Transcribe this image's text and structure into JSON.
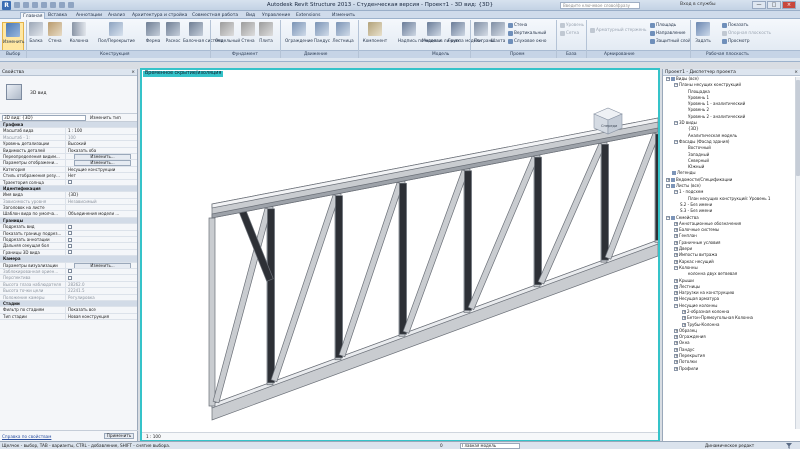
{
  "app": {
    "title": "Autodesk Revit Structure 2013 - Студенческая версия -     Проект1 - 3D вид: {3D}",
    "logo": "R",
    "search_placeholder": "Введите ключевое слово/фразу",
    "signin": "Вход в службы",
    "window_controls": [
      "—",
      "□",
      "×"
    ]
  },
  "tabs": [
    "Главная",
    "Вставка",
    "Аннотации",
    "Анализ",
    "Архитектура и стройка",
    "Совместная работа",
    "Вид",
    "Управление",
    "Extensions",
    "Изменить"
  ],
  "ribbon": {
    "buttons": [
      {
        "label": "Изменить",
        "icon": "cursor-icon"
      },
      {
        "label": "Балка",
        "icon": "beam-icon"
      },
      {
        "label": "Стена",
        "icon": "wall-icon"
      },
      {
        "label": "Колонна",
        "icon": "column-icon"
      },
      {
        "label": "Пол/Перекрытие",
        "icon": "floor-icon"
      },
      {
        "label": "Ферма",
        "icon": "truss-icon"
      },
      {
        "label": "Раскос",
        "icon": "brace-icon"
      },
      {
        "label": "Балочная система",
        "icon": "beam-system-icon"
      },
      {
        "label": "Отдельный",
        "icon": "isolated-footing-icon"
      },
      {
        "label": "Стена",
        "icon": "wall-foundation-icon"
      },
      {
        "label": "Плита",
        "icon": "slab-icon"
      },
      {
        "label": "Ограждение",
        "icon": "railing-icon"
      },
      {
        "label": "Пандус",
        "icon": "ramp-icon"
      },
      {
        "label": "Лестница",
        "icon": "stair-icon"
      },
      {
        "label": "Компонент",
        "icon": "component-icon"
      },
      {
        "label": "Надпись по модели",
        "icon": "model-text-icon"
      },
      {
        "label": "Модель в линиях",
        "icon": "model-line-icon"
      },
      {
        "label": "Группа модели",
        "icon": "model-group-icon"
      },
      {
        "label": "По грани",
        "icon": "by-face-icon"
      },
      {
        "label": "Шахта",
        "icon": "shaft-icon"
      },
      {
        "label": "Задать",
        "icon": "set-workplane-icon"
      }
    ],
    "small_items": {
      "opening": [
        "Стена",
        "Вертикальный",
        "Слуховое окно"
      ],
      "datum": [
        "Уровень",
        "Сетка"
      ],
      "rebar": [
        "Арматурный стержень"
      ],
      "workplane": [
        "Площадь",
        "Направление",
        "Защитный слой",
        "Показать",
        "Опорная плоскость",
        "Просмотр"
      ]
    },
    "panels": [
      "Выбор",
      "Конструкция",
      "Фундамент",
      "Движение",
      "Модель",
      "Проем",
      "База",
      "Армирование",
      "Рабочая плоскость"
    ]
  },
  "properties": {
    "title": "Свойства",
    "close": "×",
    "type_name": "3D вид",
    "type_select": "3D вид: {3D}",
    "edit_type": "Изменить тип",
    "rows": [
      {
        "group": "Графика"
      },
      {
        "k": "Масштаб вида",
        "v": "1 : 100"
      },
      {
        "k": "Масштаб - 1:",
        "v": "100",
        "dim": true
      },
      {
        "k": "Уровень детализации",
        "v": "Высокий"
      },
      {
        "k": "Видимость деталей",
        "v": "Показать оба"
      },
      {
        "k": "Переопределения видим...",
        "v": "Изменить...",
        "btn": true
      },
      {
        "k": "Параметры отображени...",
        "v": "Изменить...",
        "btn": true
      },
      {
        "k": "Категория",
        "v": "Несущие конструкции"
      },
      {
        "k": "Стиль отображения резу...",
        "v": "Нет"
      },
      {
        "k": "Траектория солнца",
        "cb": true
      },
      {
        "group": "Идентификация"
      },
      {
        "k": "Имя вида",
        "v": "{3D}"
      },
      {
        "k": "Зависимость уровня",
        "v": "Независимый",
        "dim": true
      },
      {
        "k": "Заголовок на листе",
        "v": ""
      },
      {
        "k": "Шаблон вида по умолча...",
        "v": "Объединения модели ..."
      },
      {
        "group": "Границы"
      },
      {
        "k": "Подрезать вид",
        "cb": true
      },
      {
        "k": "Показать границу подрез...",
        "cb": true
      },
      {
        "k": "Подрезать аннотации",
        "cb": true
      },
      {
        "k": "Дальняя секущая бол",
        "cb": true
      },
      {
        "k": "Границы 3D вида",
        "cb": true
      },
      {
        "group": "Камера"
      },
      {
        "k": "Параметры визуализации",
        "v": "Изменить...",
        "btn": true
      },
      {
        "k": "Заблокированная ориен...",
        "cb": true,
        "dim": true
      },
      {
        "k": "Перспектива",
        "cb": true,
        "dim": true
      },
      {
        "k": "Высота глаза наблюдателя",
        "v": "28262.0",
        "dim": true
      },
      {
        "k": "Высота точки цели",
        "v": "22241.5",
        "dim": true
      },
      {
        "k": "Положение камеры",
        "v": "Регулировка",
        "dim": true
      },
      {
        "group": "Стадии"
      },
      {
        "k": "Фильтр по стадиям",
        "v": "Показать все"
      },
      {
        "k": "Тип стадии",
        "v": "Новая конструкция"
      }
    ],
    "help_link": "Справка по свойствам",
    "apply": "Применить"
  },
  "viewport": {
    "label": "Временное скрытие/изоляция",
    "scale": "1 : 100",
    "viewcube_face": "Спереди"
  },
  "browser": {
    "title": "Проект1 - Диспетчер проекта",
    "close": "×",
    "nodes": [
      {
        "d": 0,
        "t": "−",
        "label": "Виды (все)",
        "icon": true
      },
      {
        "d": 1,
        "t": "−",
        "label": "Планы несущих конструкций"
      },
      {
        "d": 2,
        "label": "Площадка"
      },
      {
        "d": 2,
        "label": "Уровень 1"
      },
      {
        "d": 2,
        "label": "Уровень 1 - аналитический"
      },
      {
        "d": 2,
        "label": "Уровень 2"
      },
      {
        "d": 2,
        "label": "Уровень 2 - аналитический"
      },
      {
        "d": 1,
        "t": "−",
        "label": "3D виды"
      },
      {
        "d": 2,
        "label": "{3D}"
      },
      {
        "d": 2,
        "label": "Аналитическая модель"
      },
      {
        "d": 1,
        "t": "−",
        "label": "Фасады (Фасад здания)"
      },
      {
        "d": 2,
        "label": "Восточный"
      },
      {
        "d": 2,
        "label": "Западный"
      },
      {
        "d": 2,
        "label": "Северный"
      },
      {
        "d": 2,
        "label": "Южный"
      },
      {
        "d": 0,
        "label": "Легенды",
        "icon": true
      },
      {
        "d": 0,
        "t": "+",
        "label": "Ведомости/Спецификации",
        "icon": true
      },
      {
        "d": 0,
        "t": "−",
        "label": "Листы (все)",
        "icon": true
      },
      {
        "d": 1,
        "t": "−",
        "label": "1 - подсхем"
      },
      {
        "d": 2,
        "label": "План несущих конструкций: Уровень 1"
      },
      {
        "d": 1,
        "label": "S.2 - Без имени"
      },
      {
        "d": 1,
        "label": "S.3 - Без имени"
      },
      {
        "d": 0,
        "t": "−",
        "label": "Семейства",
        "icon": true
      },
      {
        "d": 1,
        "t": "+",
        "label": "Аннотационные обозначения"
      },
      {
        "d": 1,
        "t": "+",
        "label": "Балочные системы"
      },
      {
        "d": 1,
        "t": "+",
        "label": "Генплан"
      },
      {
        "d": 1,
        "t": "+",
        "label": "Граничные условия"
      },
      {
        "d": 1,
        "t": "+",
        "label": "Двери"
      },
      {
        "d": 1,
        "t": "+",
        "label": "Импосты витража"
      },
      {
        "d": 1,
        "t": "+",
        "label": "Каркас несущий"
      },
      {
        "d": 1,
        "t": "−",
        "label": "Колонны"
      },
      {
        "d": 2,
        "label": "колонна двух ветвевая"
      },
      {
        "d": 1,
        "t": "+",
        "label": "Крыши"
      },
      {
        "d": 1,
        "t": "+",
        "label": "Лестницы"
      },
      {
        "d": 1,
        "t": "+",
        "label": "Нагрузки на конструкцию"
      },
      {
        "d": 1,
        "t": "+",
        "label": "Несущая арматура"
      },
      {
        "d": 1,
        "t": "−",
        "label": "Несущие колонны"
      },
      {
        "d": 2,
        "t": "+",
        "label": "2-образная колонна"
      },
      {
        "d": 2,
        "t": "+",
        "label": "Бетон-Прямоугольная Колонна"
      },
      {
        "d": 2,
        "t": "+",
        "label": "Трубы-Колонна"
      },
      {
        "d": 1,
        "t": "+",
        "label": "Образец"
      },
      {
        "d": 1,
        "t": "+",
        "label": "Ограждения"
      },
      {
        "d": 1,
        "t": "+",
        "label": "Окна"
      },
      {
        "d": 1,
        "t": "+",
        "label": "Пандус"
      },
      {
        "d": 1,
        "t": "+",
        "label": "Перекрытия"
      },
      {
        "d": 1,
        "t": "+",
        "label": "Потолки"
      },
      {
        "d": 1,
        "t": "+",
        "label": "Профили"
      }
    ]
  },
  "status": {
    "text": "Щелчок - выбор, TAB - варианты, CTRL - добавление, SHIFT - снятие выбора.",
    "zero": "0",
    "model": "Главная модель",
    "right": "Динамическое редакт"
  },
  "colors": {
    "accent": "#35c3c9",
    "ribbon_selected": "#ffe7a2",
    "truss_chord": "#c9ccd0",
    "truss_diagonal": "#2d3036"
  }
}
